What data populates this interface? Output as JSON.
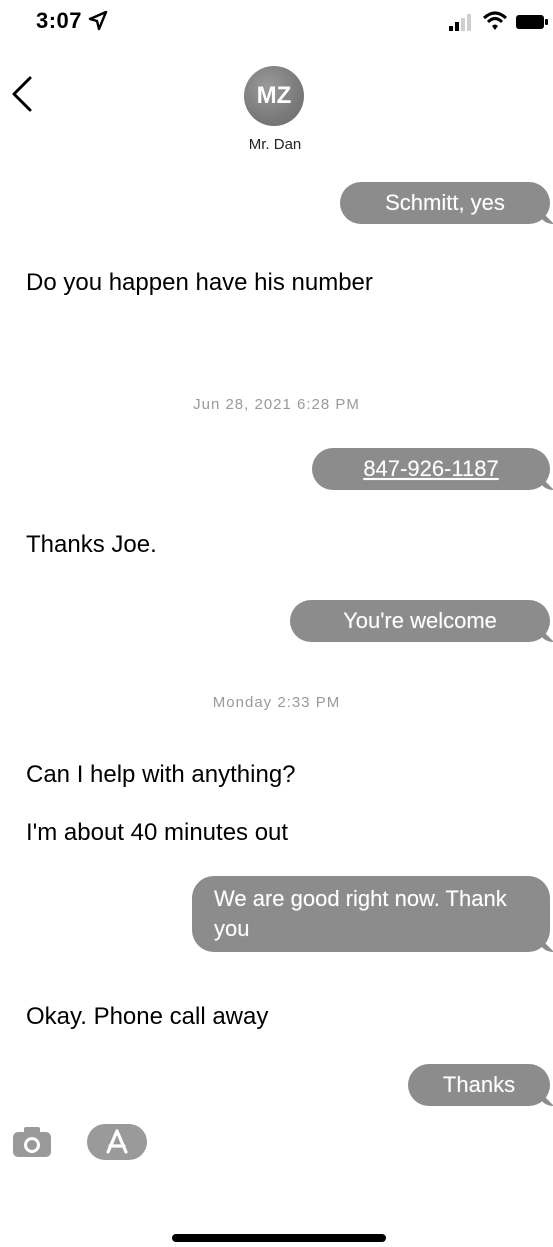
{
  "status_bar": {
    "time": "3:07"
  },
  "header": {
    "avatar_initials": "MZ",
    "contact_name": "Mr. Dan"
  },
  "messages": [
    {
      "direction": "out",
      "text": "Schmitt, yes"
    },
    {
      "direction": "in",
      "text": "Do you happen have his number"
    },
    {
      "type": "timestamp",
      "text": "Jun 28, 2021  6:28 PM"
    },
    {
      "direction": "out",
      "text": "847-926-1187"
    },
    {
      "direction": "in",
      "text": "Thanks Joe."
    },
    {
      "direction": "out",
      "text": "You're welcome"
    },
    {
      "type": "timestamp",
      "text": "Monday 2:33 PM"
    },
    {
      "direction": "in",
      "text": "Can I help with anything?"
    },
    {
      "direction": "in",
      "text": "I'm about 40 minutes out"
    },
    {
      "direction": "out",
      "text": "We are good right now. Thank you"
    },
    {
      "direction": "in",
      "text": "Okay.  Phone call away"
    },
    {
      "direction": "out",
      "text": "Thanks"
    }
  ],
  "input_bar": {
    "message_value": ""
  },
  "icons": {
    "location": "location-arrow-icon",
    "signal": "signal-icon",
    "wifi": "wifi-icon",
    "battery": "battery-icon",
    "back": "chevron-left-icon",
    "camera": "camera-icon",
    "app_store": "app-store-icon"
  },
  "colors": {
    "outgoing_bubble": "#8c8c8c",
    "timestamp_text": "#9a9a9a",
    "avatar": "#7a7a7a"
  }
}
